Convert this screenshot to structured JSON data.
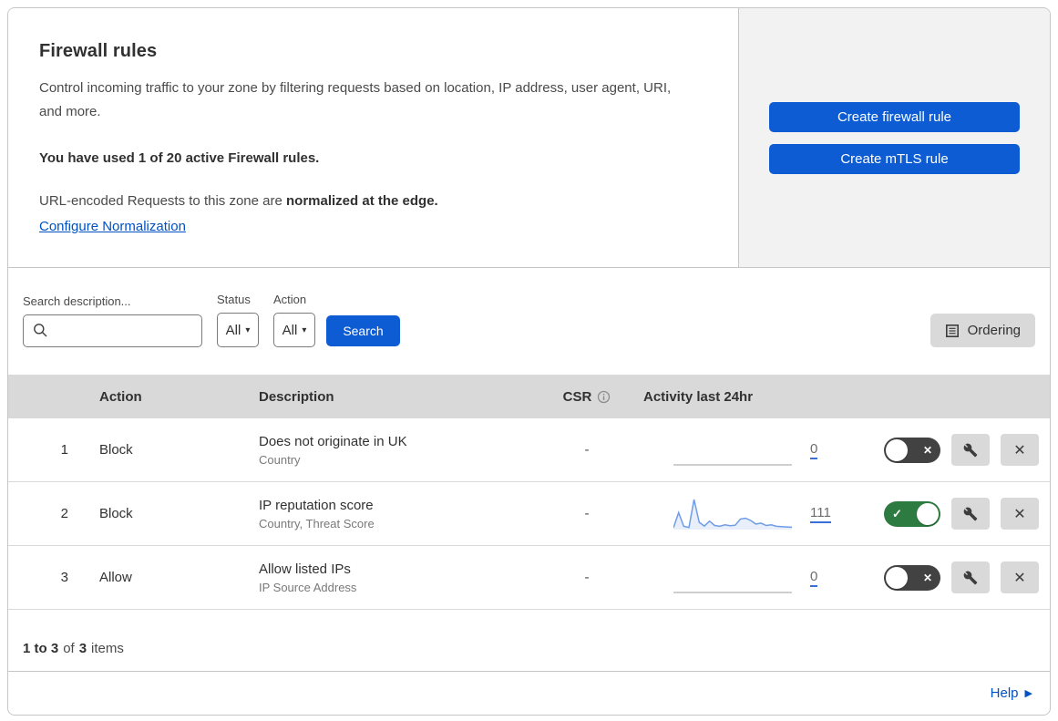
{
  "header": {
    "title": "Firewall rules",
    "description": "Control incoming traffic to your zone by filtering requests based on location, IP address, user agent, URI, and more.",
    "usage_line": "You have used 1 of 20 active Firewall rules.",
    "normalization_prefix": "URL-encoded Requests to this zone are ",
    "normalization_bold": "normalized at the edge.",
    "normalization_link": "Configure Normalization",
    "create_firewall_button": "Create firewall rule",
    "create_mtls_button": "Create mTLS rule"
  },
  "filters": {
    "search_label": "Search description...",
    "status_label": "Status",
    "status_value": "All",
    "action_label": "Action",
    "action_value": "All",
    "search_button": "Search",
    "ordering_button": "Ordering"
  },
  "table": {
    "columns": {
      "action": "Action",
      "description": "Description",
      "csr": "CSR",
      "activity": "Activity last 24hr"
    },
    "rows": [
      {
        "priority": "1",
        "action": "Block",
        "description": "Does not originate in UK",
        "fields": "Country",
        "csr": "-",
        "activity_count": "0",
        "activity_values": [],
        "enabled": false
      },
      {
        "priority": "2",
        "action": "Block",
        "description": "IP reputation score",
        "fields": "Country, Threat Score",
        "csr": "-",
        "activity_count": "111",
        "activity_values": [
          3,
          55,
          8,
          4,
          100,
          22,
          9,
          26,
          11,
          8,
          13,
          10,
          12,
          33,
          36,
          28,
          16,
          19,
          11,
          13,
          8,
          7,
          6,
          5
        ],
        "enabled": true
      },
      {
        "priority": "3",
        "action": "Allow",
        "description": "Allow listed IPs",
        "fields": "IP Source Address",
        "csr": "-",
        "activity_count": "0",
        "activity_values": [],
        "enabled": false
      }
    ]
  },
  "footer": {
    "range": "1 to 3",
    "of": "of",
    "total": "3",
    "items": "items"
  },
  "help": {
    "label": "Help"
  },
  "colors": {
    "accent_blue": "#0d5cd3",
    "link_blue": "#0051c3",
    "toggle_on_green": "#2e7b41",
    "toggle_off_gray": "#424242",
    "sparkline_blue": "#6f9ce6",
    "table_header_gray": "#d9d9d9",
    "panel_gray": "#f2f2f2"
  }
}
